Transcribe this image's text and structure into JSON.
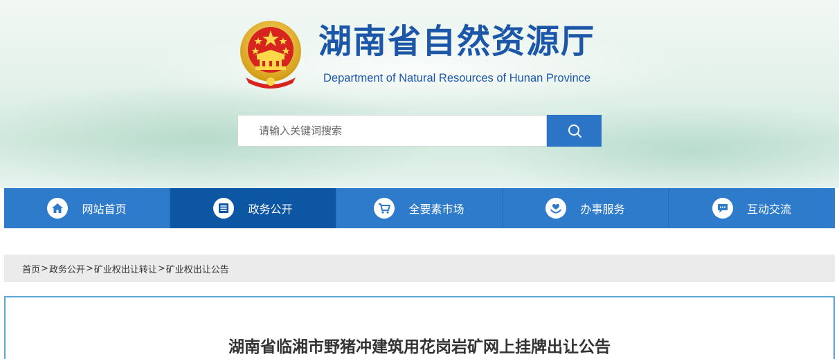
{
  "header": {
    "title": "湖南省自然资源厅",
    "subtitle": "Department of Natural Resources of Hunan Province"
  },
  "search": {
    "placeholder": "请输入关键词搜索",
    "icon": "search-icon"
  },
  "nav": {
    "items": [
      {
        "label": "网站首页",
        "icon": "home-icon"
      },
      {
        "label": "政务公开",
        "icon": "document-list-icon",
        "active": true
      },
      {
        "label": "全要素市场",
        "icon": "cart-icon"
      },
      {
        "label": "办事服务",
        "icon": "service-hands-icon"
      },
      {
        "label": "互动交流",
        "icon": "chat-bubble-icon"
      }
    ]
  },
  "breadcrumb": {
    "items": [
      "首页",
      "政务公开",
      "矿业权出让转让",
      "矿业权出让公告"
    ],
    "separator": ">"
  },
  "article": {
    "title": "湖南省临湘市野猪冲建筑用花岗岩矿网上挂牌出让公告"
  },
  "colors": {
    "brand_blue": "#1b56a8",
    "nav_blue": "#2e7bcb",
    "nav_active": "#0d56a3",
    "search_button": "#2b74c6",
    "content_border": "#5aa7d8"
  }
}
